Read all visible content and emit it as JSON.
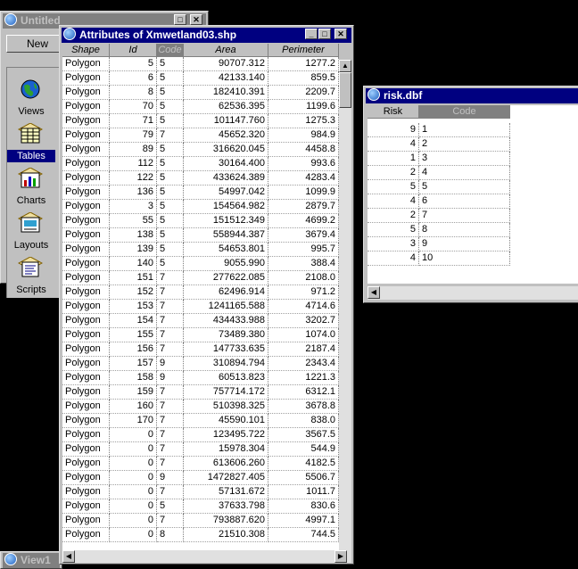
{
  "project_window": {
    "title": "Untitled",
    "new_button": "New",
    "items": [
      {
        "label": "Views",
        "icon": "globe-icon"
      },
      {
        "label": "Tables",
        "icon": "table-icon"
      },
      {
        "label": "Charts",
        "icon": "chart-icon"
      },
      {
        "label": "Layouts",
        "icon": "layout-icon"
      },
      {
        "label": "Scripts",
        "icon": "script-icon"
      }
    ],
    "selected": "Tables"
  },
  "attributes_window": {
    "title": "Attributes of Xmwetland03.shp",
    "columns": [
      "Shape",
      "Id",
      "Code",
      "Area",
      "Perimeter"
    ],
    "selected_column": "Code",
    "rows": [
      [
        "Polygon",
        "5",
        "5",
        "90707.312",
        "1277.2"
      ],
      [
        "Polygon",
        "6",
        "5",
        "42133.140",
        "859.5"
      ],
      [
        "Polygon",
        "8",
        "5",
        "182410.391",
        "2209.7"
      ],
      [
        "Polygon",
        "70",
        "5",
        "62536.395",
        "1199.6"
      ],
      [
        "Polygon",
        "71",
        "5",
        "101147.760",
        "1275.3"
      ],
      [
        "Polygon",
        "79",
        "7",
        "45652.320",
        "984.9"
      ],
      [
        "Polygon",
        "89",
        "5",
        "316620.045",
        "4458.8"
      ],
      [
        "Polygon",
        "112",
        "5",
        "30164.400",
        "993.6"
      ],
      [
        "Polygon",
        "122",
        "5",
        "433624.389",
        "4283.4"
      ],
      [
        "Polygon",
        "136",
        "5",
        "54997.042",
        "1099.9"
      ],
      [
        "Polygon",
        "3",
        "5",
        "154564.982",
        "2879.7"
      ],
      [
        "Polygon",
        "55",
        "5",
        "151512.349",
        "4699.2"
      ],
      [
        "Polygon",
        "138",
        "5",
        "558944.387",
        "3679.4"
      ],
      [
        "Polygon",
        "139",
        "5",
        "54653.801",
        "995.7"
      ],
      [
        "Polygon",
        "140",
        "5",
        "9055.990",
        "388.4"
      ],
      [
        "Polygon",
        "151",
        "7",
        "277622.085",
        "2108.0"
      ],
      [
        "Polygon",
        "152",
        "7",
        "62496.914",
        "971.2"
      ],
      [
        "Polygon",
        "153",
        "7",
        "1241165.588",
        "4714.6"
      ],
      [
        "Polygon",
        "154",
        "7",
        "434433.988",
        "3202.7"
      ],
      [
        "Polygon",
        "155",
        "7",
        "73489.380",
        "1074.0"
      ],
      [
        "Polygon",
        "156",
        "7",
        "147733.635",
        "2187.4"
      ],
      [
        "Polygon",
        "157",
        "9",
        "310894.794",
        "2343.4"
      ],
      [
        "Polygon",
        "158",
        "9",
        "60513.823",
        "1221.3"
      ],
      [
        "Polygon",
        "159",
        "7",
        "757714.172",
        "6312.1"
      ],
      [
        "Polygon",
        "160",
        "7",
        "510398.325",
        "3678.8"
      ],
      [
        "Polygon",
        "170",
        "7",
        "45590.101",
        "838.0"
      ],
      [
        "Polygon",
        "0",
        "7",
        "123495.722",
        "3567.5"
      ],
      [
        "Polygon",
        "0",
        "7",
        "15978.304",
        "544.9"
      ],
      [
        "Polygon",
        "0",
        "7",
        "613606.260",
        "4182.5"
      ],
      [
        "Polygon",
        "0",
        "9",
        "1472827.405",
        "5506.7"
      ],
      [
        "Polygon",
        "0",
        "7",
        "57131.672",
        "1011.7"
      ],
      [
        "Polygon",
        "0",
        "5",
        "37633.798",
        "830.6"
      ],
      [
        "Polygon",
        "0",
        "7",
        "793887.620",
        "4997.1"
      ],
      [
        "Polygon",
        "0",
        "8",
        "21510.308",
        "744.5"
      ]
    ]
  },
  "risk_window": {
    "title": "risk.dbf",
    "columns": [
      "Risk",
      "Code"
    ],
    "selected_column": "Code",
    "rows": [
      [
        "9",
        "1"
      ],
      [
        "4",
        "2"
      ],
      [
        "1",
        "3"
      ],
      [
        "2",
        "4"
      ],
      [
        "5",
        "5"
      ],
      [
        "4",
        "6"
      ],
      [
        "2",
        "7"
      ],
      [
        "5",
        "8"
      ],
      [
        "3",
        "9"
      ],
      [
        "4",
        "10"
      ]
    ]
  },
  "view_window": {
    "title": "View1"
  },
  "colors": {
    "desktop": "#000000",
    "active_title": "#000080",
    "inactive_title": "#808080",
    "face": "#c0c0c0"
  }
}
